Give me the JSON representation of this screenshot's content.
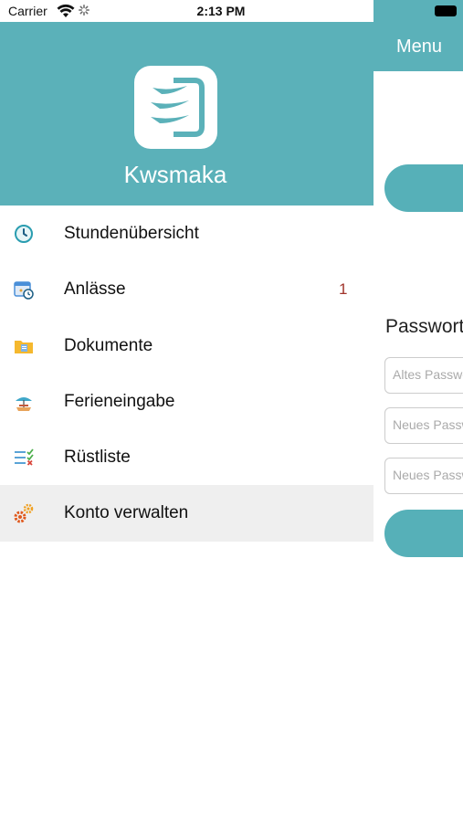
{
  "status_bar": {
    "carrier": "Carrier",
    "time": "2:13 PM"
  },
  "drawer": {
    "app_name": "Kwsmaka",
    "items": [
      {
        "label": "Stundenübersicht",
        "icon": "clock-icon",
        "badge": ""
      },
      {
        "label": "Anlässe",
        "icon": "calendar-icon",
        "badge": "1"
      },
      {
        "label": "Dokumente",
        "icon": "folder-icon",
        "badge": ""
      },
      {
        "label": "Ferieneingabe",
        "icon": "vacation-icon",
        "badge": ""
      },
      {
        "label": "Rüstliste",
        "icon": "checklist-icon",
        "badge": ""
      },
      {
        "label": "Konto verwalten",
        "icon": "gears-icon",
        "badge": ""
      }
    ],
    "active_index": 5
  },
  "main": {
    "topbar_title": "Menu",
    "password_heading": "Passwort",
    "inputs": [
      {
        "placeholder": "Altes Passwort"
      },
      {
        "placeholder": "Neues Passwort"
      },
      {
        "placeholder": "Neues Passwort"
      }
    ]
  },
  "colors": {
    "accent": "#5bb1b9",
    "badge": "#a0342b",
    "active_row": "#efefef"
  }
}
